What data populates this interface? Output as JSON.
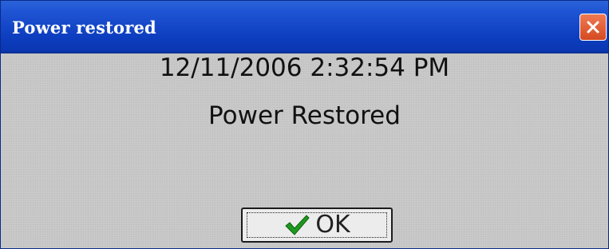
{
  "dialog": {
    "title": "Power restored",
    "timestamp": "12/11/2006 2:32:54 PM",
    "message": "Power Restored",
    "ok_label": "OK",
    "close_icon": "close-icon",
    "ok_icon": "checkmark-icon"
  },
  "colors": {
    "titlebar": "#0d3ec0",
    "close_button": "#e05a30",
    "check": "#1e9a1e"
  }
}
